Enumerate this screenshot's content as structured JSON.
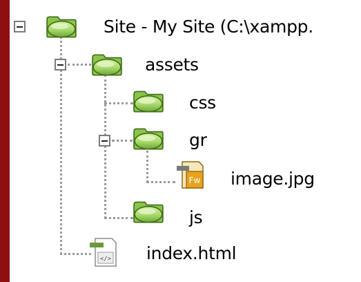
{
  "tree": {
    "root": {
      "label": "Site - My Site (C:\\xampp.",
      "icon": "folder-icon",
      "expanded": true
    },
    "assets": {
      "label": "assets",
      "icon": "folder-icon",
      "expanded": true
    },
    "css": {
      "label": "css",
      "icon": "folder-icon"
    },
    "gr": {
      "label": "gr",
      "icon": "folder-icon",
      "expanded": true
    },
    "image": {
      "label": "image.jpg",
      "icon": "fireworks-file-icon",
      "badge": "Fw"
    },
    "js": {
      "label": "js",
      "icon": "folder-icon"
    },
    "index": {
      "label": "index.html",
      "icon": "html-file-icon",
      "badge": "</>"
    }
  },
  "colors": {
    "frame": "#8e0f0f",
    "folder_fill": "#a8d86a",
    "folder_stroke": "#4a7a1e",
    "fw_fill": "#e8a21e"
  }
}
